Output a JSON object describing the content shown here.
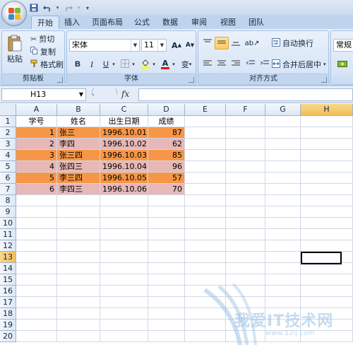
{
  "tabs": [
    "开始",
    "插入",
    "页面布局",
    "公式",
    "数据",
    "审阅",
    "视图",
    "团队"
  ],
  "active_tab": 0,
  "clipboard": {
    "paste_label": "粘贴",
    "cut_label": "剪切",
    "copy_label": "复制",
    "format_painter_label": "格式刷",
    "group_label": "剪贴板"
  },
  "font": {
    "font_name": "宋体",
    "font_size": "11",
    "grow_label": "A",
    "shrink_label": "A",
    "bold_label": "B",
    "italic_label": "I",
    "underline_label": "U",
    "font_color_label": "A",
    "phonetic_label": "变",
    "group_label": "字体",
    "fill_color": "#ffff00",
    "font_color": "#ff0000"
  },
  "alignment": {
    "wrap_text_label": "自动换行",
    "merge_center_label": "合并后居中",
    "group_label": "对齐方式"
  },
  "number": {
    "format_value": "常规"
  },
  "formula_bar": {
    "name_box": "H13",
    "fx_label": "fx",
    "formula": ""
  },
  "columns": [
    "A",
    "B",
    "C",
    "D",
    "E",
    "F",
    "G",
    "H"
  ],
  "selected_column": "H",
  "row_numbers": [
    "1",
    "2",
    "3",
    "4",
    "5",
    "6",
    "7",
    "8",
    "9",
    "10",
    "11",
    "12",
    "13",
    "14",
    "15",
    "16",
    "17",
    "18",
    "19",
    "20"
  ],
  "selected_row": "13",
  "header_row": [
    "学号",
    "姓名",
    "出生日期",
    "成绩"
  ],
  "data_rows": [
    {
      "id": "1",
      "name": "张三",
      "date": "1996.10.01",
      "score": "87"
    },
    {
      "id": "2",
      "name": "李四",
      "date": "1996.10.02",
      "score": "62"
    },
    {
      "id": "3",
      "name": "张三四",
      "date": "1996.10.03",
      "score": "85"
    },
    {
      "id": "4",
      "name": "张四三",
      "date": "1996.10.04",
      "score": "96"
    },
    {
      "id": "5",
      "name": "李三四",
      "date": "1996.10.05",
      "score": "57"
    },
    {
      "id": "6",
      "name": "李四三",
      "date": "1996.10.06",
      "score": "70"
    }
  ],
  "row_fill_colors": [
    "#f79646",
    "#e6b8b7"
  ],
  "watermark": {
    "text": "我爱IT技术网",
    "sub": "www.52ij.com"
  }
}
